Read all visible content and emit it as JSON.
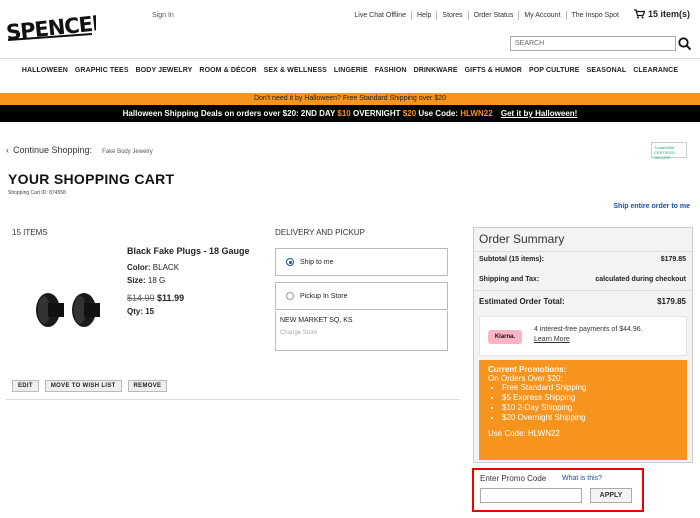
{
  "header": {
    "logo_text": "SPENCER'S",
    "signin": "Sign In",
    "links": [
      "Live Chat Offline",
      "Help",
      "Stores",
      "Order Status",
      "My Account",
      "The Inspo Spot"
    ],
    "cart_count": "15 item(s)",
    "search_placeholder": "SEARCH"
  },
  "nav": [
    "HALLOWEEN",
    "GRAPHIC TEES",
    "BODY JEWELRY",
    "ROOM & DÉCOR",
    "SEX & WELLNESS",
    "LINGERIE",
    "FASHION",
    "DRINKWARE",
    "GIFTS & HUMOR",
    "POP CULTURE",
    "SEASONAL",
    "CLEARANCE"
  ],
  "banners": {
    "orange": "Don't need it by Halloween? Free Standard Shipping over $20",
    "black_prefix": "Halloween Shipping Deals on orders over $20:",
    "two_day_label": "2ND DAY",
    "two_day_price": "$10",
    "overnight_label": "OVERNIGHT",
    "overnight_price": "$20",
    "code_label": "Use Code:",
    "code_value": "HLWN22",
    "link": "Get it by Halloween!"
  },
  "continue": {
    "label": "Continue Shopping:",
    "crumb": "Fake Body Jewelry",
    "trusted": "TrustedSite CERTIFIED SECURE"
  },
  "cart": {
    "title": "YOUR SHOPPING CART",
    "cart_id": "Shopping Cart ID: 874558",
    "ship_entire": "Ship entire order to me",
    "items_count": "15 ITEMS"
  },
  "product": {
    "name": "Black Fake Plugs - 18 Gauge",
    "color_label": "Color:",
    "color_value": "BLACK",
    "size_label": "Size:",
    "size_value": "18 G",
    "orig_price": "$14.99",
    "sale_price": "$11.99",
    "qty_label": "Qty:",
    "qty_value": "15"
  },
  "delivery": {
    "title": "DELIVERY AND PICKUP",
    "ship_option": "Ship to me",
    "pickup_option": "Pickup In Store",
    "store_name": "NEW MARKET SQ, KS",
    "change_store": "Change Store",
    "selected": "ship"
  },
  "actions": [
    "EDIT",
    "MOVE TO WISH LIST",
    "REMOVE"
  ],
  "summary": {
    "title": "Order Summary",
    "subtotal_label": "Subtotal (15 items):",
    "subtotal_value": "$179.85",
    "shipping_label": "Shipping and Tax:",
    "shipping_value": "calculated during checkout",
    "total_label": "Estimated Order Total:",
    "total_value": "$179.85",
    "klarna_logo": "Klarna.",
    "klarna_text": "4 interest-free payments of $44.96.",
    "klarna_link": "Learn More"
  },
  "promotions": {
    "title": "Current Promotions:",
    "subtitle": "On Orders Over $20:",
    "items": [
      "Free Standard Shipping",
      "$5 Express Shipping",
      "$10 2-Day Shipping",
      "$20 Overnight Shipping"
    ],
    "code": "Use Code: HLWN22"
  },
  "promo_entry": {
    "label": "Enter Promo Code",
    "what": "What is this?",
    "value": "",
    "apply": "APPLY"
  },
  "colors": {
    "accent_orange": "#f7941d",
    "link_blue": "#1a4fa0",
    "highlight_red": "#e00000"
  }
}
